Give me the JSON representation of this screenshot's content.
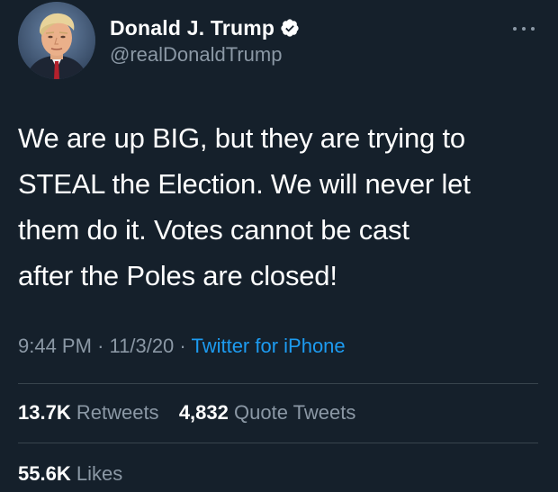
{
  "user": {
    "display_name": "Donald J. Trump",
    "handle": "@realDonaldTrump",
    "verified": true,
    "avatar_icon": "profile-photo"
  },
  "menu": {
    "icon": "more-horizontal-icon"
  },
  "tweet": {
    "text_lines": [
      "We are up BIG, but they are trying to",
      "STEAL the Election. We will never let",
      "them do it. Votes cannot be cast",
      "after the Poles are closed!"
    ]
  },
  "meta": {
    "time": "9:44 PM",
    "separator": "·",
    "date": "11/3/20",
    "source": "Twitter for iPhone"
  },
  "stats": {
    "retweets_count": "13.7K",
    "retweets_label": "Retweets",
    "quote_count": "4,832",
    "quote_label": "Quote Tweets",
    "likes_count": "55.6K",
    "likes_label": "Likes"
  },
  "colors": {
    "background": "#15202b",
    "text": "#ffffff",
    "secondary": "#8b98a5",
    "link": "#1d9bf0",
    "verified_badge": "#ffffff",
    "divider": "#38444d"
  }
}
